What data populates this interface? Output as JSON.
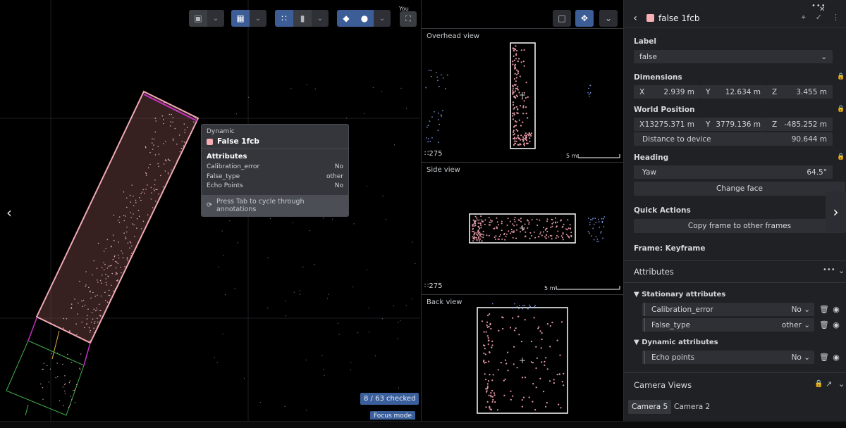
{
  "toolbar": {
    "you_label": "You",
    "groups": [
      {
        "name": "camera",
        "icons": [
          "video-camera-icon"
        ]
      },
      {
        "name": "layout",
        "icons": [
          "layout-grid-icon"
        ]
      },
      {
        "name": "points",
        "icons": [
          "point-cloud-icon",
          "label-tag-icon"
        ]
      },
      {
        "name": "layers",
        "icons": [
          "layers-icon",
          "circle-icon"
        ]
      }
    ]
  },
  "tooltip": {
    "type": "Dynamic",
    "name": "False 1fcb",
    "attributes_title": "Attributes",
    "rows": [
      {
        "key": "Calibration_error",
        "value": "No"
      },
      {
        "key": "False_type",
        "value": "other"
      },
      {
        "key": "Echo Points",
        "value": "No"
      }
    ],
    "hint": "Press Tab to cycle through annotations"
  },
  "status": {
    "checked": "8 / 63 checked",
    "focus_mode": "Focus mode"
  },
  "views": {
    "overhead": {
      "title": "Overhead view",
      "count": "275",
      "scale": "5 m"
    },
    "side": {
      "title": "Side view",
      "count": "275",
      "scale": "5 m"
    },
    "back": {
      "title": "Back view"
    }
  },
  "panel": {
    "title": "false 1fcb",
    "label_section": "Label",
    "label_value": "false",
    "dimensions_section": "Dimensions",
    "dimensions": [
      {
        "axis": "X",
        "value": "2.939 m"
      },
      {
        "axis": "Y",
        "value": "12.634 m"
      },
      {
        "axis": "Z",
        "value": "3.455 m"
      }
    ],
    "world_section": "World Position",
    "world": [
      {
        "axis": "X",
        "value": "13275.371 m"
      },
      {
        "axis": "Y",
        "value": "3779.136 m"
      },
      {
        "axis": "Z",
        "value": "-485.252 m"
      }
    ],
    "distance_label": "Distance to device",
    "distance_value": "90.644 m",
    "heading_section": "Heading",
    "yaw_label": "Yaw",
    "yaw_value": "64.5°",
    "change_face": "Change face",
    "quick_actions": "Quick Actions",
    "copy_frame": "Copy frame to other frames",
    "frame_label": "Frame: Keyframe",
    "attributes_section": "Attributes",
    "stationary_group": "Stationary attributes",
    "stationary": [
      {
        "key": "Calibration_error",
        "value": "No"
      },
      {
        "key": "False_type",
        "value": "other"
      }
    ],
    "dynamic_group": "Dynamic attributes",
    "dynamic": [
      {
        "key": "Echo points",
        "value": "No"
      }
    ],
    "camera_section": "Camera Views",
    "camera_tabs": [
      "Camera 5",
      "Camera 2"
    ]
  },
  "colors": {
    "accent_blue": "#3c5d96",
    "annotation_pink": "#f7aeb5",
    "box_pink": "#e98fc0",
    "box_magenta": "#c531c4",
    "box_green": "#42b14a",
    "point_blue": "#6f8fd8"
  }
}
